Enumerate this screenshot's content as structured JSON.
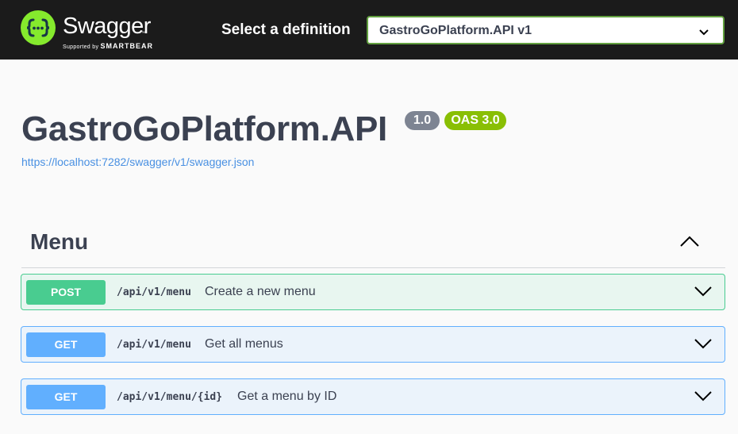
{
  "header": {
    "logo_text": "Swagger",
    "logo_tm": "™",
    "logo_sub_prefix": "Supported by",
    "logo_sub_brand": "SMARTBEAR",
    "definition_label": "Select a definition",
    "definition_selected": "GastroGoPlatform.API v1"
  },
  "info": {
    "title": "GastroGoPlatform.API",
    "version": "1.0",
    "oas": "OAS 3.0",
    "spec_url": "https://localhost:7282/swagger/v1/swagger.json"
  },
  "tag": {
    "name": "Menu"
  },
  "operations": [
    {
      "method": "POST",
      "path": "/api/v1/menu",
      "summary": "Create a new menu"
    },
    {
      "method": "GET",
      "path": "/api/v1/menu",
      "summary": "Get all menus"
    },
    {
      "method": "GET",
      "path": "/api/v1/menu/{id}",
      "summary": "Get a menu by ID"
    }
  ],
  "colors": {
    "topbar": "#1b1b1b",
    "logo_green": "#85ea2d",
    "post": "#49cc90",
    "get": "#61affe",
    "text": "#3b4151",
    "link": "#4990e2",
    "badge_version": "#7d8492",
    "badge_oas": "#89bf04"
  },
  "icons": {
    "logo": "swagger-braces-icon",
    "select_arrow": "chevron-down-icon",
    "tag_toggle": "chevron-up-icon",
    "op_expand": "chevron-down-icon"
  }
}
